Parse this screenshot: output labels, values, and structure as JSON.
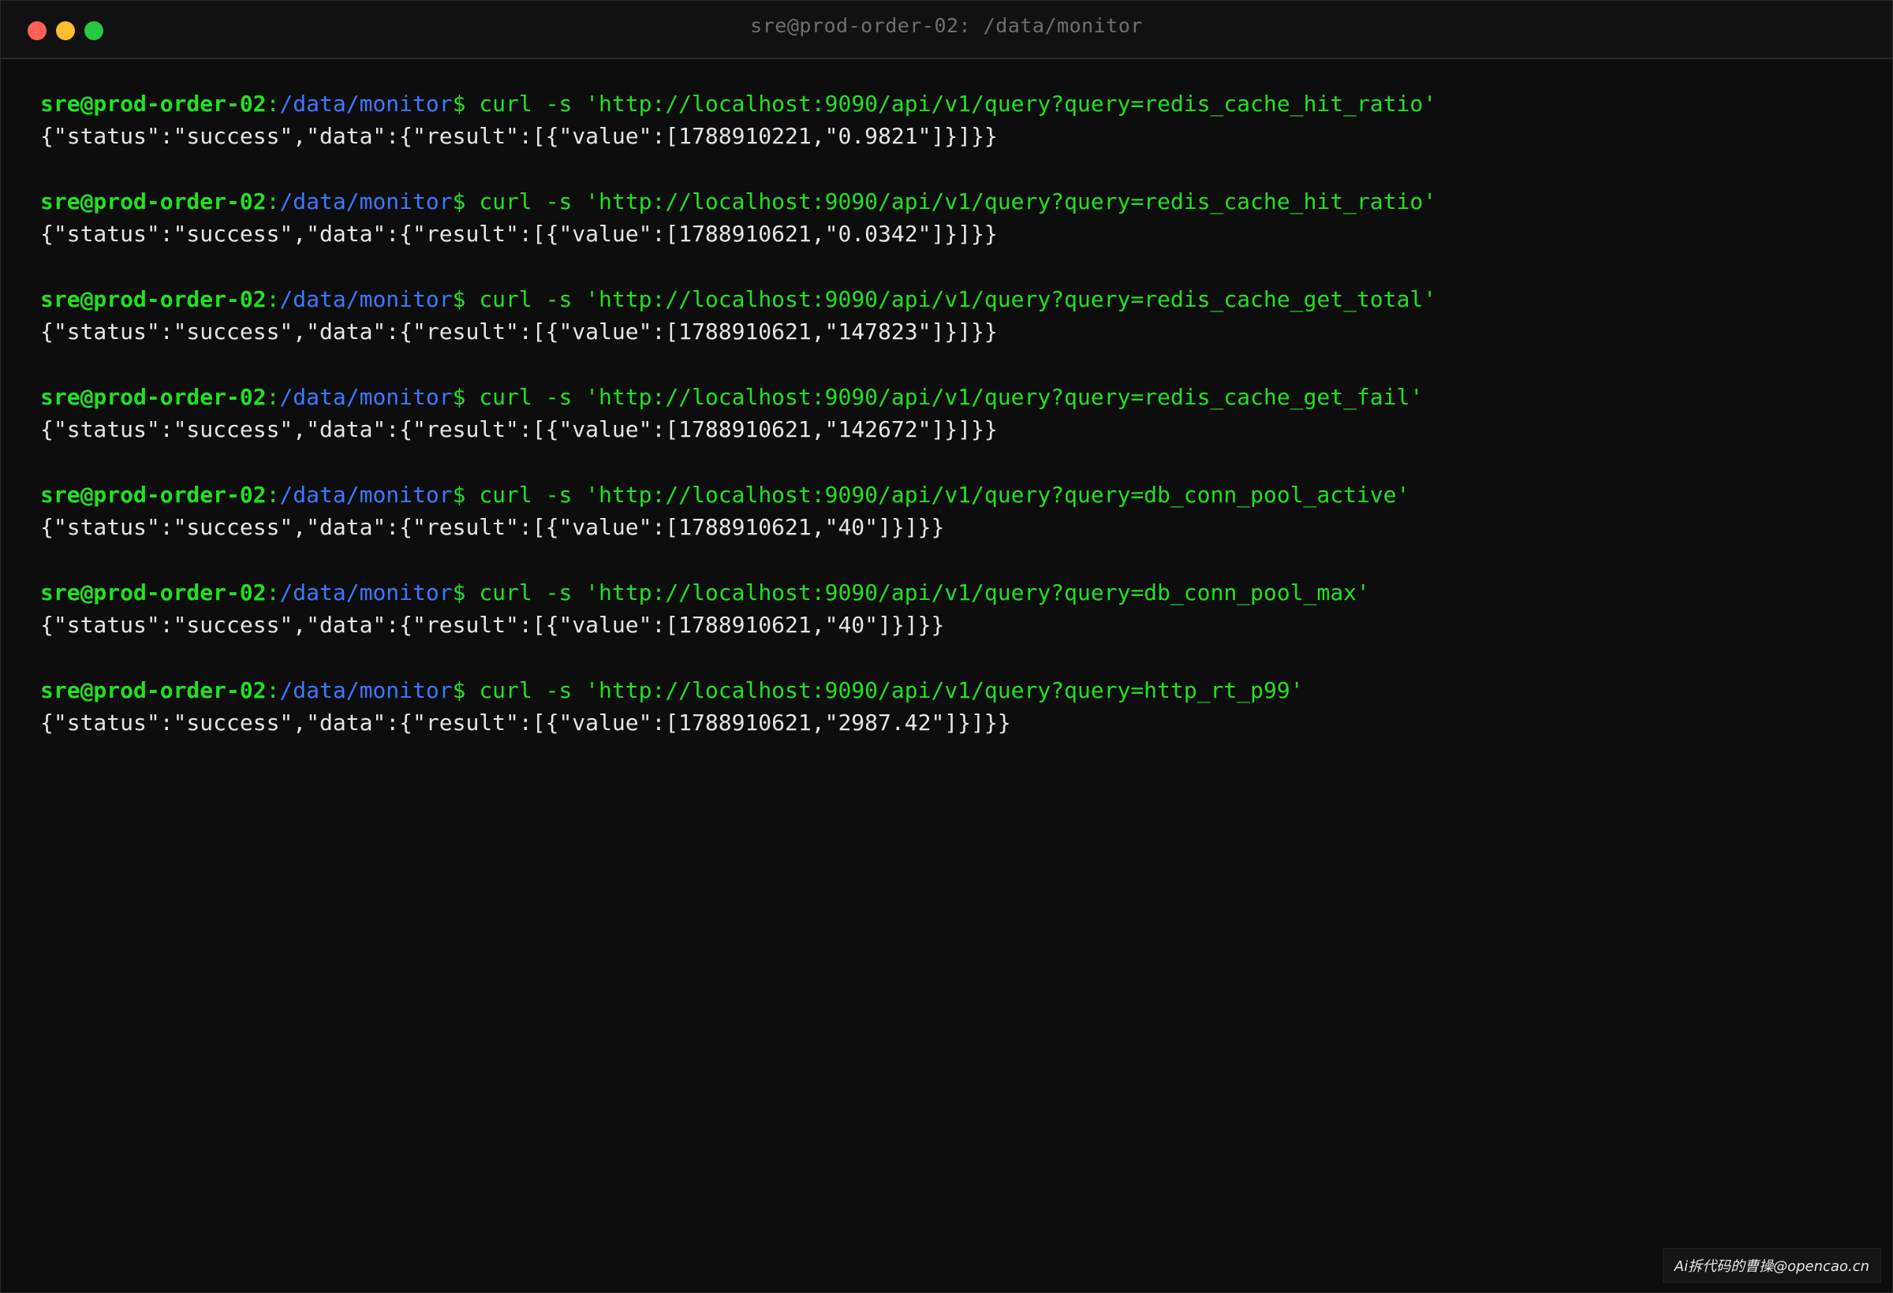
{
  "window": {
    "title": "sre@prod-order-02: /data/monitor",
    "traffic_lights": [
      {
        "name": "close",
        "color": "#ff5f57"
      },
      {
        "name": "minimize",
        "color": "#febc2e"
      },
      {
        "name": "maximize",
        "color": "#28c840"
      }
    ]
  },
  "prompt": {
    "user_host": "sre@prod-order-02",
    "colon": ":",
    "path": "/data/monitor",
    "symbol": "$"
  },
  "entries": [
    {
      "command": "curl -s 'http://localhost:9090/api/v1/query?query=redis_cache_hit_ratio'",
      "output": "{\"status\":\"success\",\"data\":{\"result\":[{\"value\":[1788910221,\"0.9821\"]}]}}"
    },
    {
      "command": "curl -s 'http://localhost:9090/api/v1/query?query=redis_cache_hit_ratio'",
      "output": "{\"status\":\"success\",\"data\":{\"result\":[{\"value\":[1788910621,\"0.0342\"]}]}}"
    },
    {
      "command": "curl -s 'http://localhost:9090/api/v1/query?query=redis_cache_get_total'",
      "output": "{\"status\":\"success\",\"data\":{\"result\":[{\"value\":[1788910621,\"147823\"]}]}}"
    },
    {
      "command": "curl -s 'http://localhost:9090/api/v1/query?query=redis_cache_get_fail'",
      "output": "{\"status\":\"success\",\"data\":{\"result\":[{\"value\":[1788910621,\"142672\"]}]}}"
    },
    {
      "command": "curl -s 'http://localhost:9090/api/v1/query?query=db_conn_pool_active'",
      "output": "{\"status\":\"success\",\"data\":{\"result\":[{\"value\":[1788910621,\"40\"]}]}}"
    },
    {
      "command": "curl -s 'http://localhost:9090/api/v1/query?query=db_conn_pool_max'",
      "output": "{\"status\":\"success\",\"data\":{\"result\":[{\"value\":[1788910621,\"40\"]}]}}"
    },
    {
      "command": "curl -s 'http://localhost:9090/api/v1/query?query=http_rt_p99'",
      "output": "{\"status\":\"success\",\"data\":{\"result\":[{\"value\":[1788910621,\"2987.42\"]}]}}"
    }
  ],
  "watermark": "Ai拆代码的曹操@opencao.cn"
}
